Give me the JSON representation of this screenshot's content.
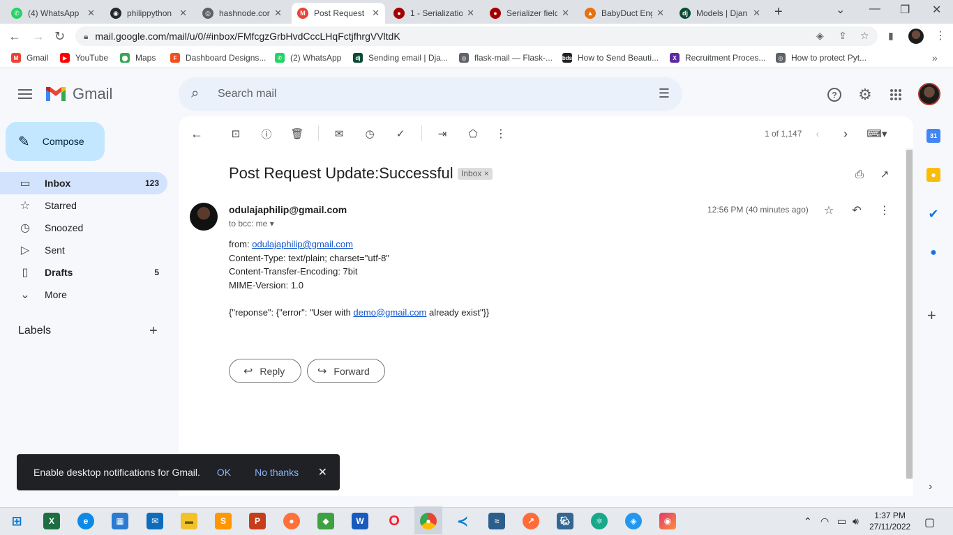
{
  "browser": {
    "tabs": [
      {
        "label": "(4) WhatsApp",
        "color": "#25d366",
        "glyph": "✆"
      },
      {
        "label": "philippython",
        "color": "#24292f",
        "glyph": "◉"
      },
      {
        "label": "hashnode.cor",
        "color": "#5f6368",
        "glyph": "◎"
      },
      {
        "label": "Post Request",
        "color": "#ea4335",
        "glyph": "M",
        "active": true
      },
      {
        "label": "1 - Serializatio",
        "color": "#a30000",
        "glyph": "●"
      },
      {
        "label": "Serializer field",
        "color": "#a30000",
        "glyph": "●"
      },
      {
        "label": "BabyDuct Eng",
        "color": "#e8710a",
        "glyph": "▲"
      },
      {
        "label": "Models | Djan",
        "color": "#0c4b33",
        "glyph": "dj"
      }
    ],
    "url": "mail.google.com/mail/u/0/#inbox/FMfcgzGrbHvdCccLHqFctjfhrgVVltdK",
    "bookmarks": [
      {
        "label": "Gmail",
        "color": "#ea4335",
        "glyph": "M"
      },
      {
        "label": "YouTube",
        "color": "#ff0000",
        "glyph": "▶"
      },
      {
        "label": "Maps",
        "color": "#34a853",
        "glyph": "⬤"
      },
      {
        "label": "Dashboard Designs...",
        "color": "#f24e1e",
        "glyph": "F"
      },
      {
        "label": "(2) WhatsApp",
        "color": "#25d366",
        "glyph": "✆"
      },
      {
        "label": "Sending email | Dja...",
        "color": "#0c4b33",
        "glyph": "dj"
      },
      {
        "label": "flask-mail — Flask-...",
        "color": "#5f6368",
        "glyph": "◎"
      },
      {
        "label": "How to Send Beauti...",
        "color": "#202124",
        "glyph": "bds"
      },
      {
        "label": "Recruitment Proces...",
        "color": "#5b2aa0",
        "glyph": "X"
      },
      {
        "label": "How to protect Pyt...",
        "color": "#5f6368",
        "glyph": "◎"
      }
    ]
  },
  "gmail": {
    "logo_text": "Gmail",
    "search_placeholder": "Search mail",
    "compose_label": "Compose",
    "nav": [
      {
        "label": "Inbox",
        "count": "123",
        "icon": "inbox-icon",
        "glyph": "▭",
        "active": true
      },
      {
        "label": "Starred",
        "count": "",
        "icon": "star-icon",
        "glyph": "☆"
      },
      {
        "label": "Snoozed",
        "count": "",
        "icon": "clock-icon",
        "glyph": "◷"
      },
      {
        "label": "Sent",
        "count": "",
        "icon": "send-icon",
        "glyph": "▷"
      },
      {
        "label": "Drafts",
        "count": "5",
        "icon": "draft-icon",
        "glyph": "▯",
        "bold": true
      },
      {
        "label": "More",
        "count": "",
        "icon": "chevron-down-icon",
        "glyph": "⌄"
      }
    ],
    "labels_header": "Labels",
    "pager": "1 of 1,147",
    "email": {
      "subject": "Post Request Update:Successful",
      "label_chip": "Inbox",
      "sender": "odulajaphilip@gmail.com",
      "to": "to bcc: me",
      "time": "12:56 PM (40 minutes ago)",
      "from_label": "from: ",
      "from_link": "odulajaphilip@gmail.com",
      "line_content_type": "Content-Type: text/plain; charset=\"utf-8\"",
      "line_encoding": "Content-Transfer-Encoding: 7bit",
      "line_mime": "MIME-Version: 1.0",
      "json_prefix": "{\"reponse\": {\"error\": \"User with ",
      "json_link": "demo@gmail.com",
      "json_suffix": " already exist\"}}"
    },
    "reply_label": "Reply",
    "forward_label": "Forward",
    "snackbar": {
      "text": "Enable desktop notifications for Gmail.",
      "ok": "OK",
      "no_thanks": "No thanks"
    }
  },
  "taskbar": {
    "time": "1:37 PM",
    "date": "27/11/2022"
  }
}
